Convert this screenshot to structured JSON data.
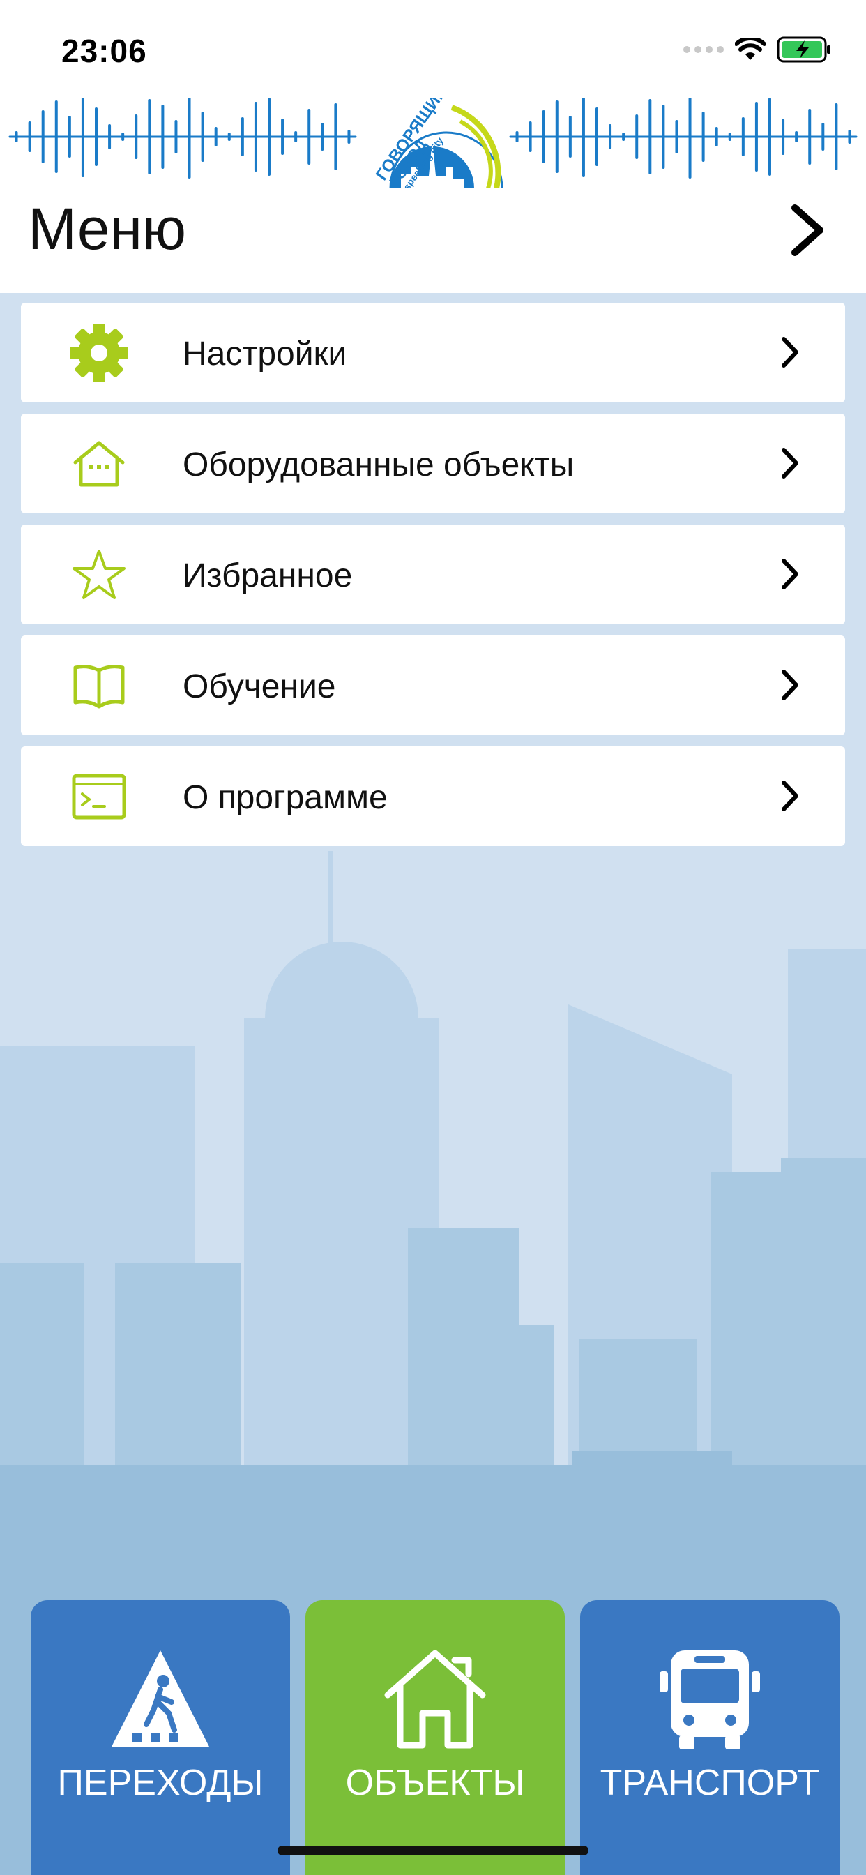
{
  "status_bar": {
    "time": "23:06"
  },
  "header": {
    "logo_text_line1": "ГОВОРЯЩИЙ",
    "logo_text_line2": "ГОРОД",
    "logo_text_line3": "speaking city",
    "title": "Меню"
  },
  "menu": {
    "items": [
      {
        "label": "Настройки",
        "icon": "gear-icon"
      },
      {
        "label": "Оборудованные объекты",
        "icon": "house-icon"
      },
      {
        "label": "Избранное",
        "icon": "star-icon"
      },
      {
        "label": "Обучение",
        "icon": "book-icon"
      },
      {
        "label": "О программе",
        "icon": "terminal-icon"
      }
    ]
  },
  "bottom_nav": {
    "items": [
      {
        "label": "ПЕРЕХОДЫ",
        "icon": "pedestrian-crossing-icon",
        "color": "#3a78c2"
      },
      {
        "label": "ОБЪЕКТЫ",
        "icon": "house-outline-icon",
        "color": "#7bbf38"
      },
      {
        "label": "ТРАНСПОРТ",
        "icon": "bus-icon",
        "color": "#3a78c2"
      }
    ]
  },
  "colors": {
    "accent_green": "#a8cc1c",
    "nav_blue": "#3a78c2",
    "nav_green": "#7bbf38",
    "logo_blue": "#1a7bc8",
    "background": "#d0e0f0"
  }
}
